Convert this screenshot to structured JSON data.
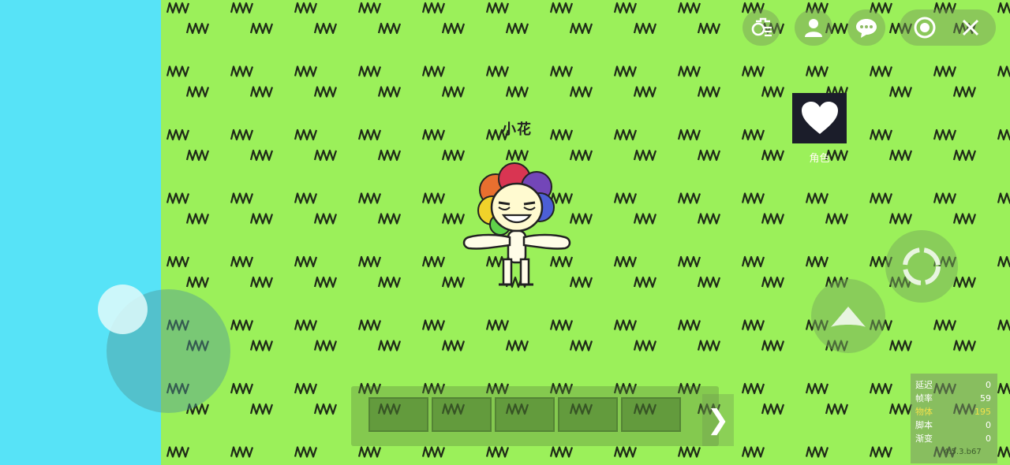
{
  "player": {
    "name": "小花"
  },
  "heart_panel": {
    "label": "角色"
  },
  "top_bar": {
    "buttons": [
      {
        "id": "item-settings",
        "icon": "list-gear-icon"
      },
      {
        "id": "profile",
        "icon": "person-icon"
      },
      {
        "id": "chat",
        "icon": "chat-bubble-icon"
      },
      {
        "id": "record",
        "icon": "record-icon"
      },
      {
        "id": "close",
        "icon": "close-icon"
      }
    ]
  },
  "hotbar": {
    "slot_count": 5,
    "next_icon": "❯"
  },
  "stats": [
    {
      "label": "延迟",
      "value": "0",
      "highlight": false
    },
    {
      "label": "帧率",
      "value": "59",
      "highlight": false
    },
    {
      "label": "物体",
      "value": "195",
      "highlight": true
    },
    {
      "label": "脚本",
      "value": "0",
      "highlight": false
    },
    {
      "label": "渐变",
      "value": "0",
      "highlight": false
    }
  ],
  "version": "4.5.3.b67",
  "colors": {
    "sky": "#57e3f7",
    "grass": "#9bf05a",
    "heart_bg": "#1b1d2a"
  }
}
